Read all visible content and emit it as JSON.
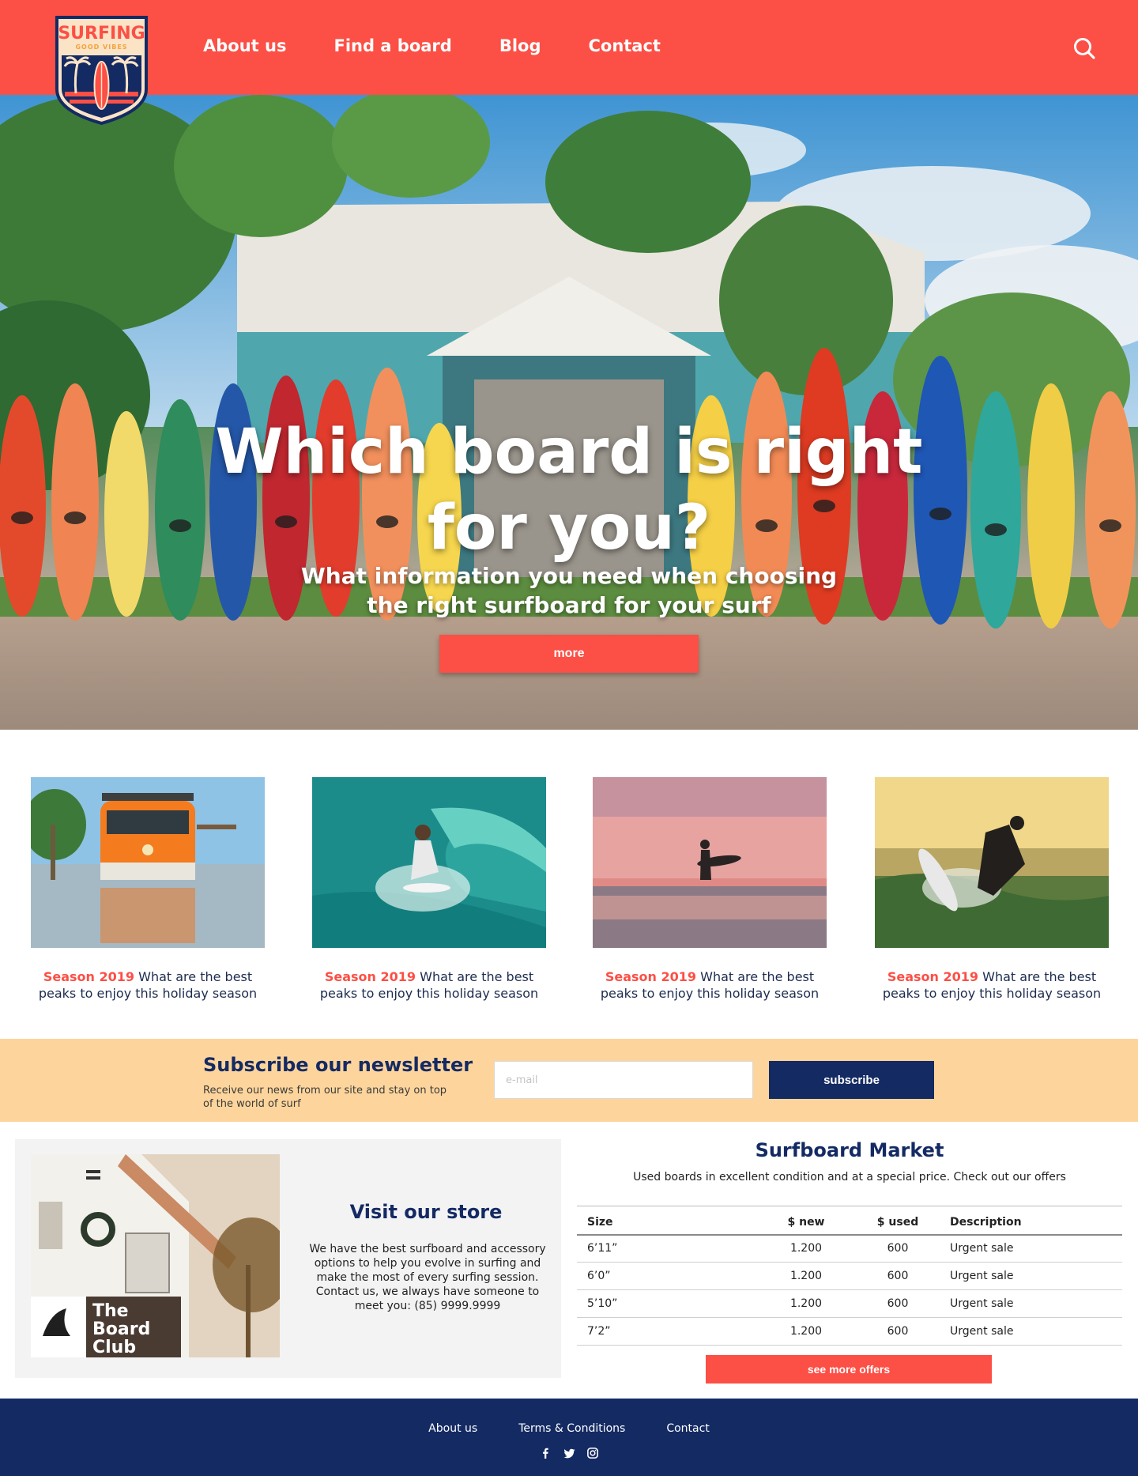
{
  "brand": {
    "logo_text": "SURFING",
    "logo_tagline": "GOOD VIBES"
  },
  "nav": {
    "items": [
      {
        "label": "About us"
      },
      {
        "label": "Find a board"
      },
      {
        "label": "Blog"
      },
      {
        "label": "Contact"
      }
    ]
  },
  "hero": {
    "title": "Which board is right for you?",
    "subtitle": "What information you need when choosing the right surfboard for your surf",
    "button_label": "more"
  },
  "cards": [
    {
      "season": "Season 2019",
      "text": " What are the best peaks to enjoy this holiday season",
      "image": "orange-van-beach"
    },
    {
      "season": "Season 2019",
      "text": " What are the best peaks to enjoy this holiday season",
      "image": "surfer-tube-wave"
    },
    {
      "season": "Season 2019",
      "text": " What are the best peaks to enjoy this holiday season",
      "image": "surfer-sunset-silhouette"
    },
    {
      "season": "Season 2019",
      "text": " What are the best peaks to enjoy this holiday season",
      "image": "surfer-carving-wave"
    }
  ],
  "newsletter": {
    "title": "Subscribe our newsletter",
    "description": "Receive our news from our site and stay on top of the world of surf",
    "email_placeholder": "e-mail",
    "button_label": "subscribe"
  },
  "store": {
    "title": "Visit our store",
    "description": "We have the best surfboard and accessory options to help you evolve in surfing and make the most of every surfing session. Contact us, we always have someone to meet you: (85) 9999.9999",
    "sign_text": "The Board Club"
  },
  "market": {
    "title": "Surfboard Market",
    "subtitle": "Used boards in excellent condition and at a special price. Check out our offers",
    "columns": [
      "Size",
      "$ new",
      "$ used",
      "Description"
    ],
    "rows": [
      [
        "6’11”",
        "1.200",
        "600",
        "Urgent sale"
      ],
      [
        "6’0”",
        "1.200",
        "600",
        "Urgent sale"
      ],
      [
        "5’10”",
        "1.200",
        "600",
        "Urgent sale"
      ],
      [
        "7’2”",
        "1.200",
        "600",
        "Urgent sale"
      ]
    ],
    "button_label": "see more offers"
  },
  "footer": {
    "links": [
      {
        "label": "About us"
      },
      {
        "label": "Terms & Conditions"
      },
      {
        "label": "Contact"
      }
    ],
    "social": [
      "facebook-icon",
      "twitter-icon",
      "instagram-icon"
    ]
  },
  "colors": {
    "primary_red": "#fc4f45",
    "navy": "#142a63",
    "sand": "#fdd59c",
    "store_bg": "#f3f3f3"
  }
}
